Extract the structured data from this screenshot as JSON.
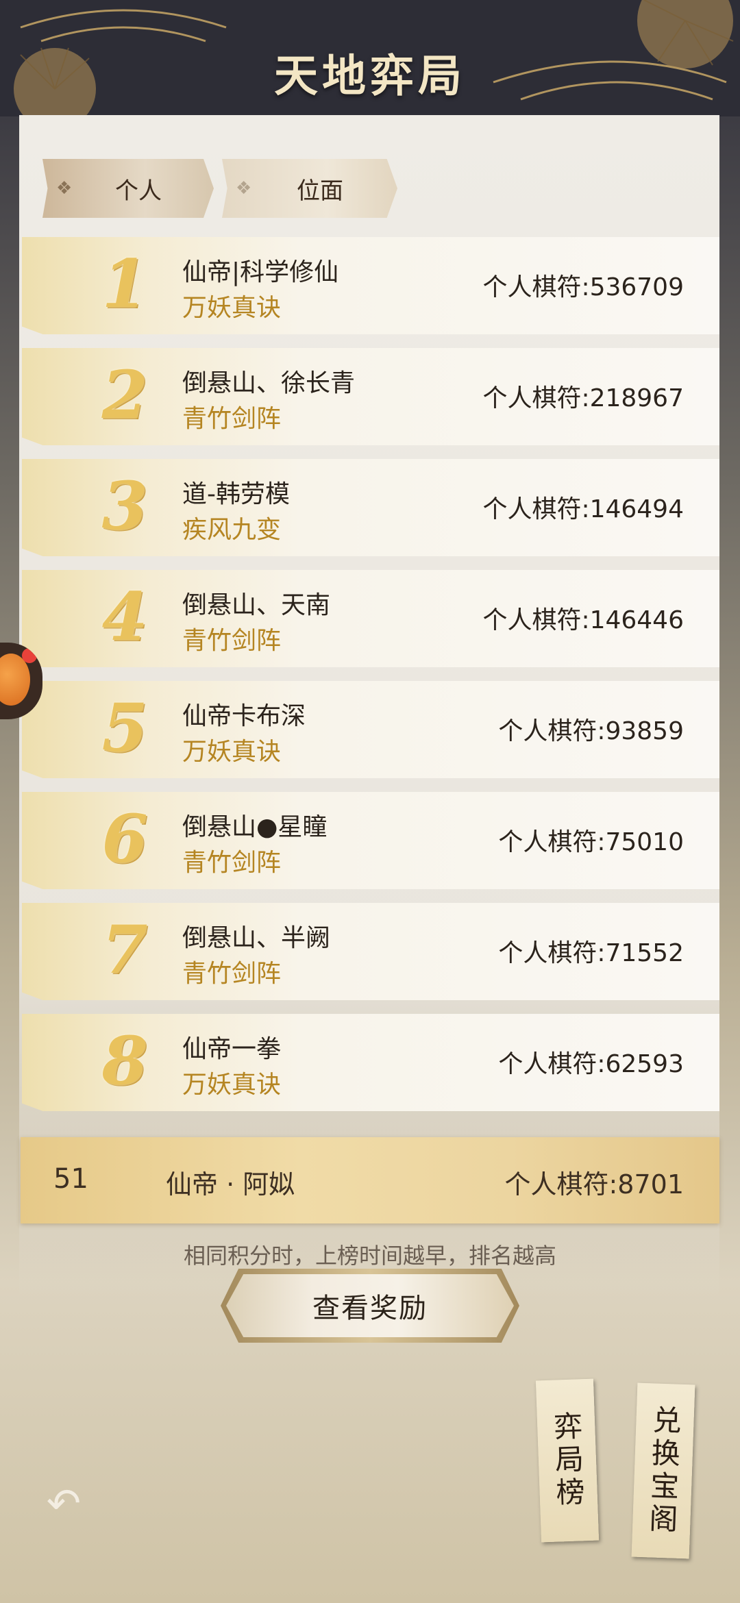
{
  "header": {
    "title": "天地弈局"
  },
  "tabs": [
    {
      "label": "个人",
      "icon": "diamond-icon",
      "selected": true
    },
    {
      "label": "位面",
      "icon": "diamond-icon",
      "selected": false
    }
  ],
  "leaderboard": [
    {
      "rank": "1",
      "name": "仙帝|科学修仙",
      "sect": "万妖真诀",
      "score": "个人棋符:536709"
    },
    {
      "rank": "2",
      "name": "倒悬山、徐长青",
      "sect": "青竹剑阵",
      "score": "个人棋符:218967"
    },
    {
      "rank": "3",
      "name": "道-韩劳模",
      "sect": "疾风九变",
      "score": "个人棋符:146494"
    },
    {
      "rank": "4",
      "name": "倒悬山、天南",
      "sect": "青竹剑阵",
      "score": "个人棋符:146446"
    },
    {
      "rank": "5",
      "name": "仙帝卡布深",
      "sect": "万妖真诀",
      "score": "个人棋符:93859"
    },
    {
      "rank": "6",
      "name": "倒悬山●星瞳",
      "sect": "青竹剑阵",
      "score": "个人棋符:75010"
    },
    {
      "rank": "7",
      "name": "倒悬山、半阙",
      "sect": "青竹剑阵",
      "score": "个人棋符:71552"
    },
    {
      "rank": "8",
      "name": "仙帝一拳",
      "sect": "万妖真诀",
      "score": "个人棋符:62593"
    }
  ],
  "my_entry": {
    "rank": "51",
    "name": "仙帝 · 阿姒",
    "score": "个人棋符:8701"
  },
  "hint": "相同积分时，上榜时间越早，排名越高",
  "reward_button": "查看奖励",
  "side_tags": {
    "rank_board": "弈局榜",
    "exchange": "兑换宝阁"
  },
  "icons": {
    "back": "back-arrow-icon",
    "floating": "pet-avatar-icon"
  },
  "colors": {
    "gold": "#b58522",
    "rank_gold": "#e9c25d",
    "dark_text": "#2b231c"
  }
}
